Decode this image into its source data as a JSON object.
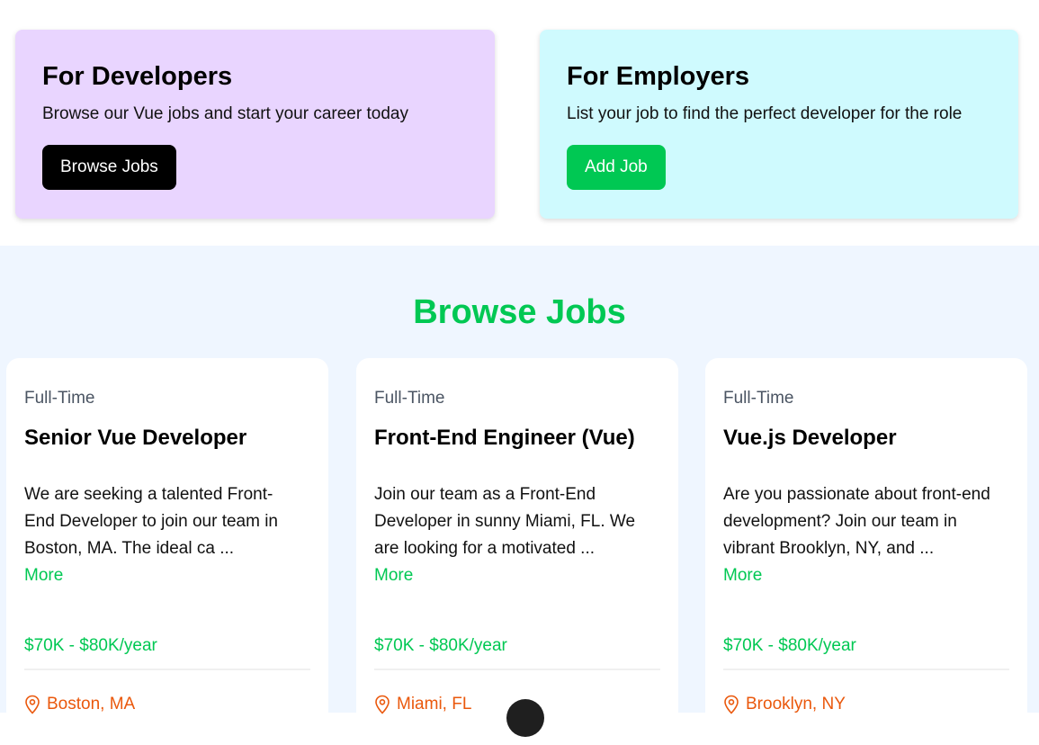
{
  "hero": {
    "developers": {
      "title": "For Developers",
      "description": "Browse our Vue jobs and start your career today",
      "button_label": "Browse Jobs"
    },
    "employers": {
      "title": "For Employers",
      "description": "List your job to find the perfect developer for the role",
      "button_label": "Add Job"
    }
  },
  "jobs": {
    "heading": "Browse Jobs",
    "more_label": "More",
    "items": [
      {
        "type": "Full-Time",
        "title": "Senior Vue Developer",
        "description": "We are seeking a talented Front-End Developer to join our team in Boston, MA. The ideal ca ...",
        "salary": "$70K - $80K/year",
        "location": "Boston, MA"
      },
      {
        "type": "Full-Time",
        "title": "Front-End Engineer (Vue)",
        "description": "Join our team as a Front-End Developer in sunny Miami, FL. We are looking for a motivated ...",
        "salary": "$70K - $80K/year",
        "location": "Miami, FL"
      },
      {
        "type": "Full-Time",
        "title": "Vue.js Developer",
        "description": "Are you passionate about front-end development? Join our team in vibrant Brooklyn, NY, and ...",
        "salary": "$70K - $80K/year",
        "location": "Brooklyn, NY"
      }
    ]
  },
  "icons": {
    "location": "map-pin-icon"
  },
  "colors": {
    "accent_green": "#00c853",
    "developers_card_bg": "#e9d5ff",
    "employers_card_bg": "#cffafe",
    "location_orange": "#ea580c"
  }
}
